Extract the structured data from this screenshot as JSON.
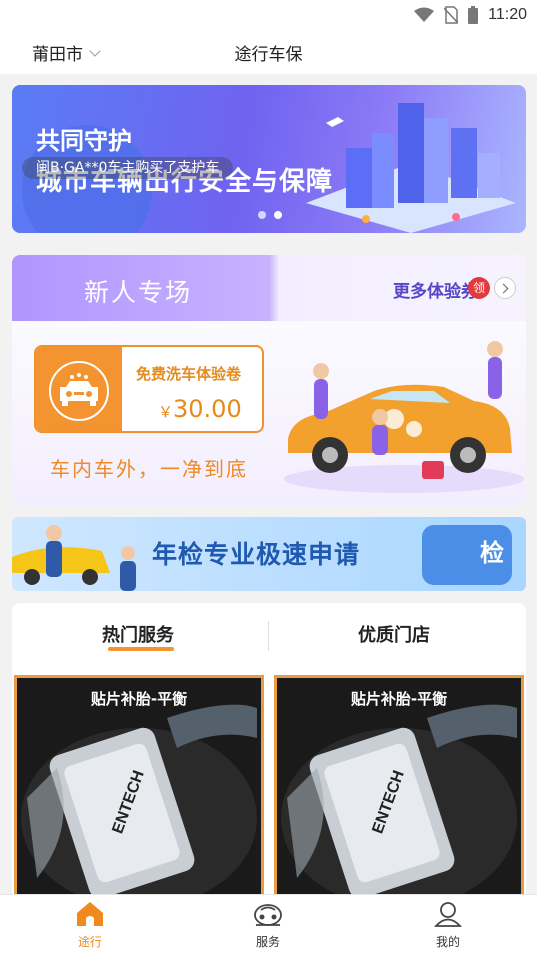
{
  "status_bar": {
    "time": "11:20"
  },
  "header": {
    "city": "莆田市",
    "title": "途行车保"
  },
  "banner": {
    "title_line1": "共同守护",
    "title_line2": "城市车辆出行安全与保障",
    "ticker": "闽B·GA**0车主购买了支护车",
    "dots": 2,
    "active_dot": 1
  },
  "promo": {
    "title": "新人专场",
    "more_label": "更多体验券",
    "claim_badge": "领",
    "coupon_name": "免费洗车体验卷",
    "coupon_currency": "￥",
    "coupon_price": "30.00",
    "slogan": "车内车外，一净到底"
  },
  "inspection_banner": {
    "text": "年检专业极速申请",
    "badge": "检"
  },
  "tabs": [
    {
      "label": "热门服务",
      "active": true
    },
    {
      "label": "优质门店",
      "active": false
    }
  ],
  "service_cards": [
    {
      "title": "贴片补胎-平衡"
    },
    {
      "title": "贴片补胎-平衡"
    }
  ],
  "bottom_nav": [
    {
      "label": "途行",
      "icon": "home-icon",
      "active": true
    },
    {
      "label": "服务",
      "icon": "car-service-icon",
      "active": false
    },
    {
      "label": "我的",
      "icon": "profile-icon",
      "active": false
    }
  ],
  "colors": {
    "accent": "#f08a1e",
    "banner_blue": "#6f63f0",
    "promo_purple": "#b195ff"
  }
}
